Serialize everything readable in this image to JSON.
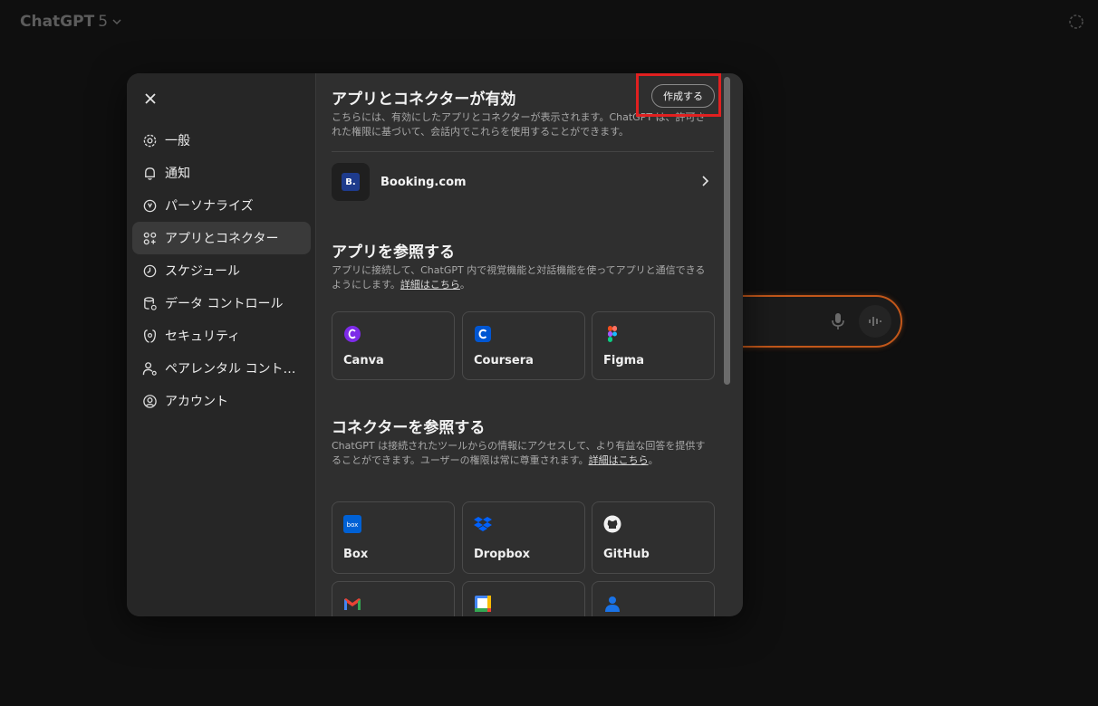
{
  "topbar": {
    "model_name": "ChatGPT",
    "model_version": "5"
  },
  "sidebar": {
    "items": [
      {
        "label": "一般",
        "icon": "gear-icon"
      },
      {
        "label": "通知",
        "icon": "bell-icon"
      },
      {
        "label": "パーソナライズ",
        "icon": "personalize-icon"
      },
      {
        "label": "アプリとコネクター",
        "icon": "apps-icon",
        "active": true
      },
      {
        "label": "スケジュール",
        "icon": "clock-icon"
      },
      {
        "label": "データ コントロール",
        "icon": "database-icon"
      },
      {
        "label": "セキュリティ",
        "icon": "shield-icon"
      },
      {
        "label": "ペアレンタル コント…",
        "icon": "parental-icon"
      },
      {
        "label": "アカウント",
        "icon": "account-icon"
      }
    ]
  },
  "content": {
    "enabled_title": "アプリとコネクターが有効",
    "create_label": "作成する",
    "enabled_desc": "こちらには、有効にしたアプリとコネクターが表示されます。ChatGPT は、許可された権限に基づいて、会話内でこれらを使用することができます。",
    "enabled_apps": [
      {
        "name": "Booking.com",
        "logo_text": "B."
      }
    ],
    "apps_title": "アプリを参照する",
    "apps_desc": "アプリに接続して、ChatGPT 内で視覚機能と対話機能を使ってアプリと通信できるようにします。",
    "apps_link": "詳細はこちら",
    "apps": [
      {
        "name": "Canva",
        "icon": "canva-icon"
      },
      {
        "name": "Coursera",
        "icon": "coursera-icon"
      },
      {
        "name": "Figma",
        "icon": "figma-icon"
      }
    ],
    "connectors_title": "コネクターを参照する",
    "connectors_desc": "ChatGPT は接続されたツールからの情報にアクセスして、より有益な回答を提供することができます。ユーザーの権限は常に尊重されます。",
    "connectors_link": "詳細はこちら",
    "connectors": [
      {
        "name": "Box",
        "icon": "box-icon"
      },
      {
        "name": "Dropbox",
        "icon": "dropbox-icon"
      },
      {
        "name": "GitHub",
        "icon": "github-icon"
      },
      {
        "name": "",
        "icon": "gmail-icon"
      },
      {
        "name": "",
        "icon": "google-calendar-icon"
      },
      {
        "name": "",
        "icon": "contacts-icon"
      }
    ]
  },
  "colors": {
    "accent_highlight": "#e02020",
    "composer_border": "#c2571a",
    "canva": "#7d2ae8",
    "coursera": "#0056d2",
    "dropbox": "#0061fe",
    "box": "#0061d5"
  }
}
